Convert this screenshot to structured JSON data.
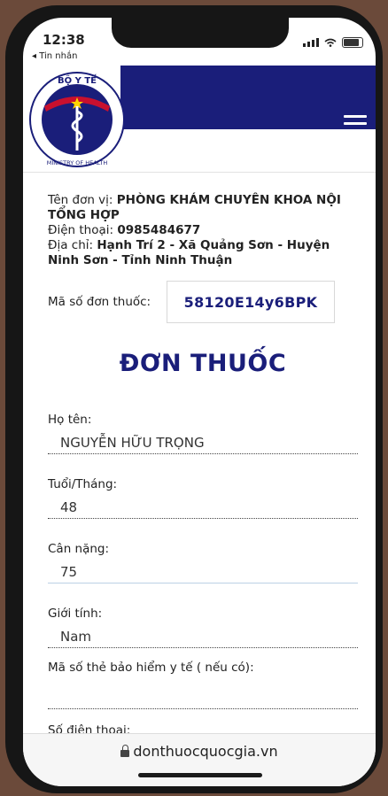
{
  "status": {
    "time": "12:38",
    "back_app": "◂ Tin nhắn"
  },
  "logo": {
    "top_text": "BỘ Y TẾ",
    "bottom_text": "MINISTRY OF HEALTH"
  },
  "clinic": {
    "unit_label": "Tên đơn vị: ",
    "unit_value": "PHÒNG KHÁM CHUYÊN KHOA NỘI TỔNG HỢP",
    "phone_label": "Điện thoại: ",
    "phone_value": "0985484677",
    "address_label": "Địa chỉ: ",
    "address_value": "Hạnh Trí 2 - Xã Quảng Sơn - Huyện Ninh Sơn - Tỉnh Ninh Thuận"
  },
  "prescription": {
    "code_label": "Mã số đơn thuốc:",
    "code_value": "58120E14y6BPK"
  },
  "title": "ĐƠN THUỐC",
  "fields": [
    {
      "label": "Họ tên:",
      "value": "NGUYỄN HỮU TRỌNG"
    },
    {
      "label": "Tuổi/Tháng:",
      "value": "48"
    },
    {
      "label": "Cân nặng:",
      "value": "75"
    },
    {
      "label": "Giới tính:",
      "value": "Nam"
    },
    {
      "label": "Mã số thẻ bảo hiểm y tế ( nếu có):",
      "value": ""
    },
    {
      "label": "Số điện thoại:",
      "value": ""
    }
  ],
  "browser": {
    "url": "donthuocquocgia.vn"
  },
  "colors": {
    "brand": "#1a1e7a",
    "ribbon": "#1a1e7a"
  }
}
